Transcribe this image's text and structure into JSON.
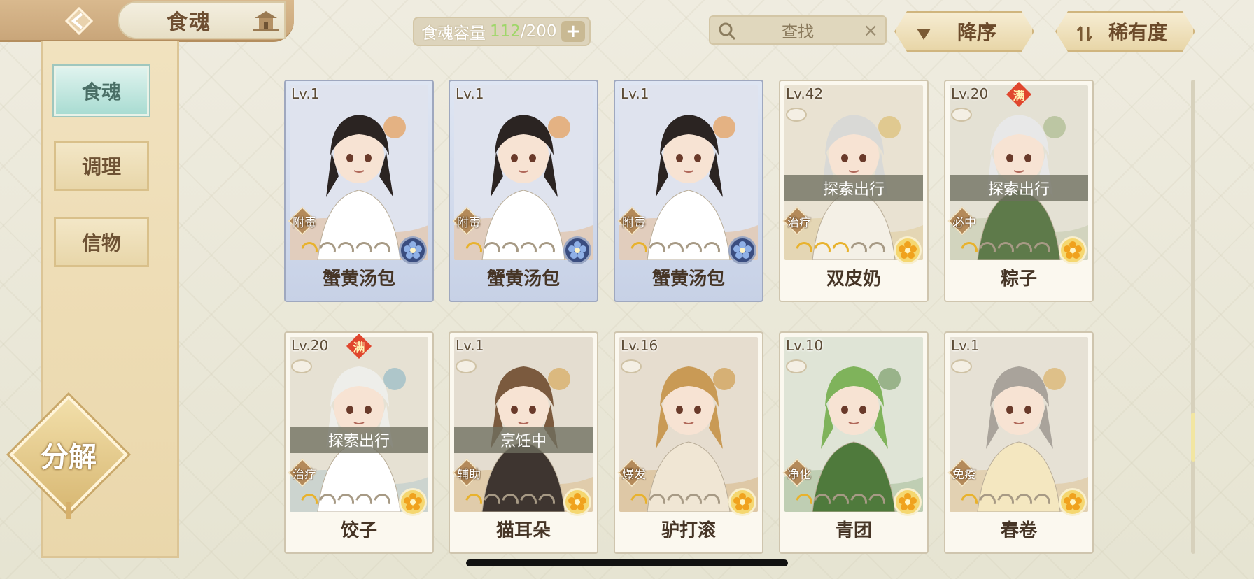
{
  "header": {
    "title": "食魂",
    "icons": {
      "back": "back-arrow-icon",
      "home": "house-roof-icon"
    }
  },
  "capacity": {
    "label": "食魂容量",
    "current": "112",
    "separator": "/",
    "max": "200",
    "add_label": "+"
  },
  "search": {
    "placeholder": "查找",
    "clear_label": "×"
  },
  "sort": {
    "order_label": "降序",
    "rarity_label": "稀有度"
  },
  "tabs": [
    {
      "label": "食魂",
      "active": true
    },
    {
      "label": "调理",
      "active": false
    },
    {
      "label": "信物",
      "active": false
    }
  ],
  "decompose_label": "分解",
  "colors": {
    "accent_teal": "#a9dcd2",
    "gold": "#e8b22d",
    "panel": "#ead7ab",
    "full_badge": "#e0462e"
  },
  "cards": [
    {
      "level": "Lv.1",
      "name": "蟹黄汤包",
      "role": "附毒",
      "stars_on": 1,
      "rarity": "blue",
      "status": "",
      "full": "",
      "selected": true,
      "cup": false,
      "art": "white-hooded-boy"
    },
    {
      "level": "Lv.1",
      "name": "蟹黄汤包",
      "role": "附毒",
      "stars_on": 1,
      "rarity": "blue",
      "status": "",
      "full": "",
      "selected": true,
      "cup": false,
      "art": "white-hooded-boy"
    },
    {
      "level": "Lv.1",
      "name": "蟹黄汤包",
      "role": "附毒",
      "stars_on": 1,
      "rarity": "blue",
      "status": "",
      "full": "",
      "selected": true,
      "cup": false,
      "art": "white-hooded-boy"
    },
    {
      "level": "Lv.42",
      "name": "双皮奶",
      "role": "治疗",
      "stars_on": 3,
      "rarity": "gold",
      "status": "探索出行",
      "full": "",
      "selected": false,
      "cup": true,
      "art": "straw-hat-boy"
    },
    {
      "level": "Lv.20",
      "name": "粽子",
      "role": "必中",
      "stars_on": 1,
      "rarity": "gold",
      "status": "探索出行",
      "full": "满",
      "selected": false,
      "cup": true,
      "art": "white-hair-green-robe"
    },
    {
      "level": "Lv.20",
      "name": "饺子",
      "role": "治疗",
      "stars_on": 1,
      "rarity": "gold",
      "status": "探索出行",
      "full": "满",
      "selected": false,
      "cup": true,
      "art": "white-hair-boy"
    },
    {
      "level": "Lv.1",
      "name": "猫耳朵",
      "role": "辅助",
      "stars_on": 1,
      "rarity": "gold",
      "status": "烹饪中",
      "full": "",
      "selected": false,
      "cup": true,
      "art": "brown-hair-boy"
    },
    {
      "level": "Lv.16",
      "name": "驴打滚",
      "role": "爆发",
      "stars_on": 1,
      "rarity": "gold",
      "status": "",
      "full": "",
      "selected": false,
      "cup": true,
      "art": "blonde-braid-boy"
    },
    {
      "level": "Lv.10",
      "name": "青团",
      "role": "净化",
      "stars_on": 1,
      "rarity": "gold",
      "status": "",
      "full": "",
      "selected": false,
      "cup": true,
      "art": "green-hair-umbrella"
    },
    {
      "level": "Lv.1",
      "name": "春卷",
      "role": "免疫",
      "stars_on": 1,
      "rarity": "gold",
      "status": "",
      "full": "",
      "selected": false,
      "cup": true,
      "art": "gray-hair-girl"
    }
  ]
}
